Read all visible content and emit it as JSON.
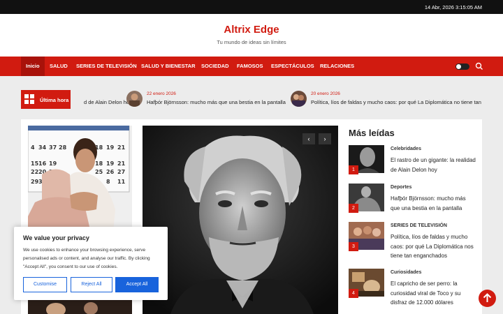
{
  "topbar": {
    "datetime": "14 Abr, 2026 3:15:05 AM"
  },
  "site": {
    "title": "Altrix Edge",
    "tagline": "Tu mundo de ideas sin límites"
  },
  "nav": {
    "items": [
      "Inicio",
      "SALUD",
      "SERIES DE TELEVISIÓN",
      "SALUD Y BIENESTAR",
      "SOCIEDAD",
      "FAMOSOS",
      "ESPECTÁCULOS",
      "RELACIONES"
    ]
  },
  "ticker": {
    "label": "Última hora",
    "items": [
      {
        "date": "",
        "text": "d de Alain Delon hoy"
      },
      {
        "date": "22 enero 2026",
        "text": "Hafþór Björnsson: mucho más que una bestia en la pantalla"
      },
      {
        "date": "20 enero 2026",
        "text": "Política, líos de faldas y mucho caos: por qué La Diplomática no tiene tan e"
      }
    ]
  },
  "sidebar": {
    "title": "Más leídas",
    "items": [
      {
        "num": "1",
        "category": "Celebridades",
        "title": "El rastro de un gigante: la realidad de Alain Delon hoy"
      },
      {
        "num": "2",
        "category": "Deportes",
        "title": "Hafþór Björnsson: mucho más que una bestia en la pantalla"
      },
      {
        "num": "3",
        "category": "SERIES DE TELEVISIÓN",
        "title": "Política, líos de faldas y mucho caos: por qué La Diplomática nos tiene tan enganchados"
      },
      {
        "num": "4",
        "category": "Curiosidades",
        "title": "El capricho de ser perro: la curiosidad viral de Toco y su disfraz de 12.000 dólares"
      }
    ]
  },
  "cookie": {
    "heading": "We value your privacy",
    "body": "We use cookies to enhance your browsing experience, serve personalised ads or content, and analyse our traffic. By clicking \"Accept All\", you consent to our use of cookies.",
    "customise": "Customise",
    "reject": "Reject All",
    "accept": "Accept All"
  },
  "hero": {
    "prev": "‹",
    "next": "›"
  },
  "colors": {
    "brand": "#d11b10",
    "cookie_blue": "#1863dc"
  }
}
